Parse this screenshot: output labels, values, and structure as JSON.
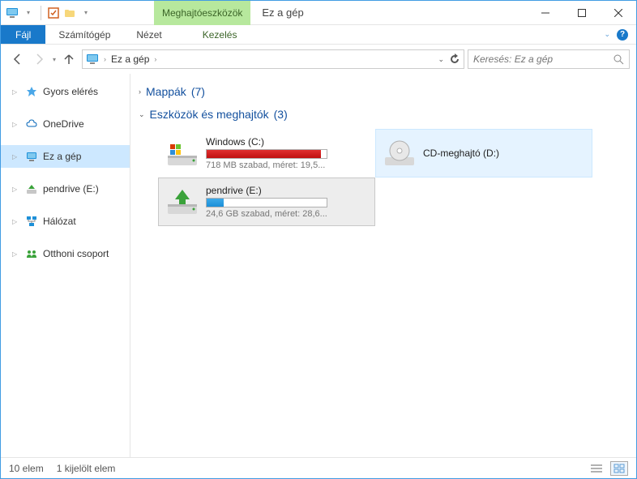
{
  "window": {
    "contextual_tab": "Meghajtóeszközök",
    "title": "Ez a gép"
  },
  "ribbon": {
    "file": "Fájl",
    "computer": "Számítógép",
    "view": "Nézet",
    "manage": "Kezelés"
  },
  "nav": {
    "breadcrumb": "Ez a gép",
    "search_placeholder": "Keresés: Ez a gép"
  },
  "sidebar": {
    "items": [
      {
        "label": "Gyors elérés"
      },
      {
        "label": "OneDrive"
      },
      {
        "label": "Ez a gép"
      },
      {
        "label": "pendrive (E:)"
      },
      {
        "label": "Hálózat"
      },
      {
        "label": "Otthoni csoport"
      }
    ]
  },
  "groups": {
    "folders": {
      "label": "Mappák",
      "count": "(7)"
    },
    "drives": {
      "label": "Eszközök és meghajtók",
      "count": "(3)"
    }
  },
  "drives": [
    {
      "name": "Windows (C:)",
      "sub": "718 MB szabad, méret: 19,5...",
      "fill_pct": 95,
      "color": "red",
      "type": "hdd"
    },
    {
      "name": "CD-meghajtó (D:)",
      "sub": "",
      "fill_pct": 0,
      "color": "",
      "type": "cd"
    },
    {
      "name": "pendrive (E:)",
      "sub": "24,6 GB szabad, méret: 28,6...",
      "fill_pct": 14,
      "color": "blue",
      "type": "usb"
    }
  ],
  "status": {
    "items": "10 elem",
    "selected": "1 kijelölt elem"
  }
}
